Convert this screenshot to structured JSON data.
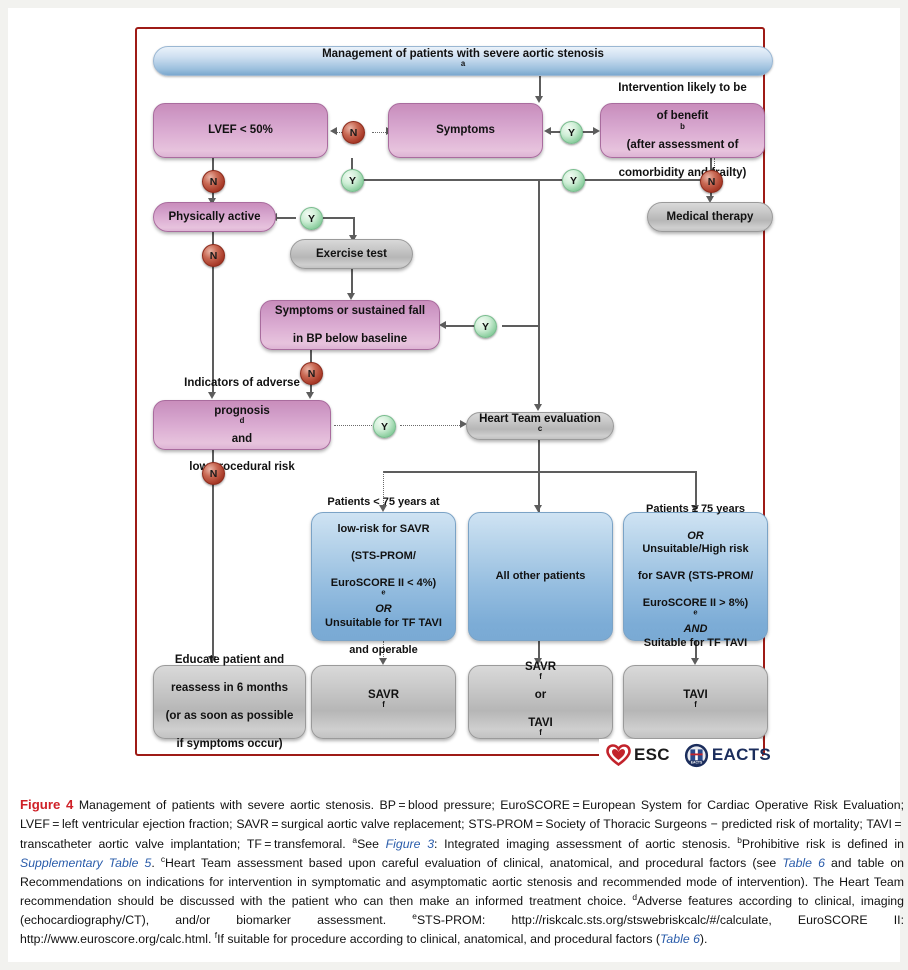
{
  "figure": {
    "label": "Figure 4",
    "title": "Management of patients with severe aortic stenosis."
  },
  "header": {
    "text": "Management of patients with severe aortic stenosis",
    "sup": "a"
  },
  "nodes": {
    "lvef": "LVEF < 50%",
    "symptoms": "Symptoms",
    "intervention_l1": "Intervention likely to be",
    "intervention_l2_a": "of benefit",
    "intervention_l2_sup": "b",
    "intervention_l2_b": " (after assessment of",
    "intervention_l3": "comorbidity and frailty)",
    "medical_therapy": "Medical therapy",
    "physically_active": "Physically active",
    "exercise_test": "Exercise test",
    "symptoms_fall_l1": "Symptoms or sustained fall",
    "symptoms_fall_l2": "in BP below baseline",
    "indicators_l1": "Indicators of adverse",
    "indicators_l2_a": "prognosis",
    "indicators_l2_sup": "d",
    "indicators_l2_b": " and",
    "indicators_l3": "low procedural risk",
    "heart_team_a": "Heart Team evaluation",
    "heart_team_sup": "c",
    "cat_left_l1": "Patients < 75 years at",
    "cat_left_l2": "low-risk for SAVR",
    "cat_left_l3": "(STS-PROM/",
    "cat_left_l4_a": "EuroSCORE II < 4%)",
    "cat_left_l4_sup": "e",
    "cat_left_l5": "OR",
    "cat_left_l6": "Unsuitable for TF TAVI",
    "cat_left_l7": "and operable",
    "cat_mid": "All other patients",
    "cat_right_l1": "Patients ≥ 75 years",
    "cat_right_l2": "OR",
    "cat_right_l3": "Unsuitable/High risk",
    "cat_right_l4": "for SAVR (STS-PROM/",
    "cat_right_l5_a": "EuroSCORE II > 8%)",
    "cat_right_l5_sup": "e",
    "cat_right_l6": "AND",
    "cat_right_l7": "Suitable for TF TAVI",
    "educate_l1": "Educate patient and",
    "educate_l2": "reassess in 6 months",
    "educate_l3": "(or as soon as possible",
    "educate_l4": "if symptoms occur)",
    "out_savr_a": "SAVR",
    "out_savr_sup": "f",
    "out_savr_or_l1_a": "SAVR",
    "out_savr_or_l1_sup": "f",
    "out_savr_or_l2": "or",
    "out_savr_or_l3_a": "TAVI",
    "out_savr_or_l3_sup": "f",
    "out_tavi_a": "TAVI",
    "out_tavi_sup": "f"
  },
  "badges": {
    "n1": "N",
    "n2": "N",
    "n3": "N",
    "n4": "N",
    "n5": "N",
    "n6": "N",
    "y1": "Y",
    "y2": "Y",
    "y3": "Y",
    "y4": "Y",
    "y5": "Y"
  },
  "logos": {
    "esc": "ESC",
    "eacts": "EACTS",
    "eacts_inner": "EACTS"
  },
  "caption": {
    "p1": "Management of patients with severe aortic stenosis. BP = blood pressure; EuroSCORE = European System for Cardiac Operative Risk Evaluation; LVEF = left ventricular ejection fraction; SAVR = surgical aortic valve replacement; STS-PROM = Society of Thoracic Surgeons − predicted risk of mortality; TAVI = transcatheter aortic valve implantation; TF = transfemoral. ",
    "sup_a": "a",
    "p2_pre": "See ",
    "link_fig3": "Figure 3",
    "p2_post": ": Integrated imaging assessment of aortic stenosis. ",
    "sup_b": "b",
    "p3_pre": "Prohibitive risk is defined in ",
    "link_suppl": "Supplementary Table 5",
    "p3_post": ". ",
    "sup_c": "c",
    "p4_pre": "Heart Team assessment based upon careful evaluation of clinical, anatomical, and procedural factors (see ",
    "link_table6a": "Table 6",
    "p4_post": " and table on Recommendations on indications for intervention in symptomatic and asymptomatic aortic stenosis and recommended mode of intervention). The Heart Team recommendation should be discussed with the patient who can then make an informed treatment choice. ",
    "sup_d": "d",
    "p5": "Adverse features according to clinical, imaging (echocardiography/CT), and/or biomarker assessment. ",
    "sup_e": "e",
    "p6": "STS-PROM: http://riskcalc.sts.org/stswebriskcalc/#/calculate, EuroSCORE II: http://www.euroscore.org/calc.html. ",
    "sup_f": "f",
    "p7_pre": "If suitable for procedure according to clinical, anatomical, and procedural factors (",
    "link_table6b": "Table 6",
    "p7_post": ")."
  },
  "colors": {
    "frame": "#9e1b16",
    "fig_label": "#cf2027",
    "link": "#2a5caa",
    "badge_yes": "#8fd0a2",
    "badge_no": "#a83a28",
    "pink_node": "#dcaed3",
    "blue_node": "#93bcdf",
    "grey_node": "#c9c9c9"
  }
}
